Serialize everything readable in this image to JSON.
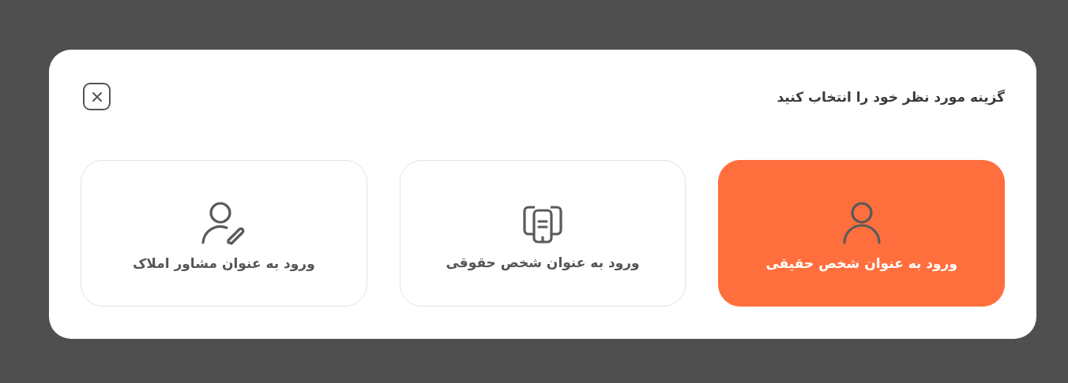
{
  "dialog": {
    "title": "گزینه مورد نظر خود را انتخاب کنید",
    "options": [
      {
        "kind": "person",
        "label": "ورود به عنوان شخص حقیقی",
        "selected": true
      },
      {
        "kind": "company",
        "label": "ورود به عنوان شخص حقوقی",
        "selected": false
      },
      {
        "kind": "agent",
        "label": "ورود به عنوان مشاور املاک",
        "selected": false
      }
    ]
  }
}
